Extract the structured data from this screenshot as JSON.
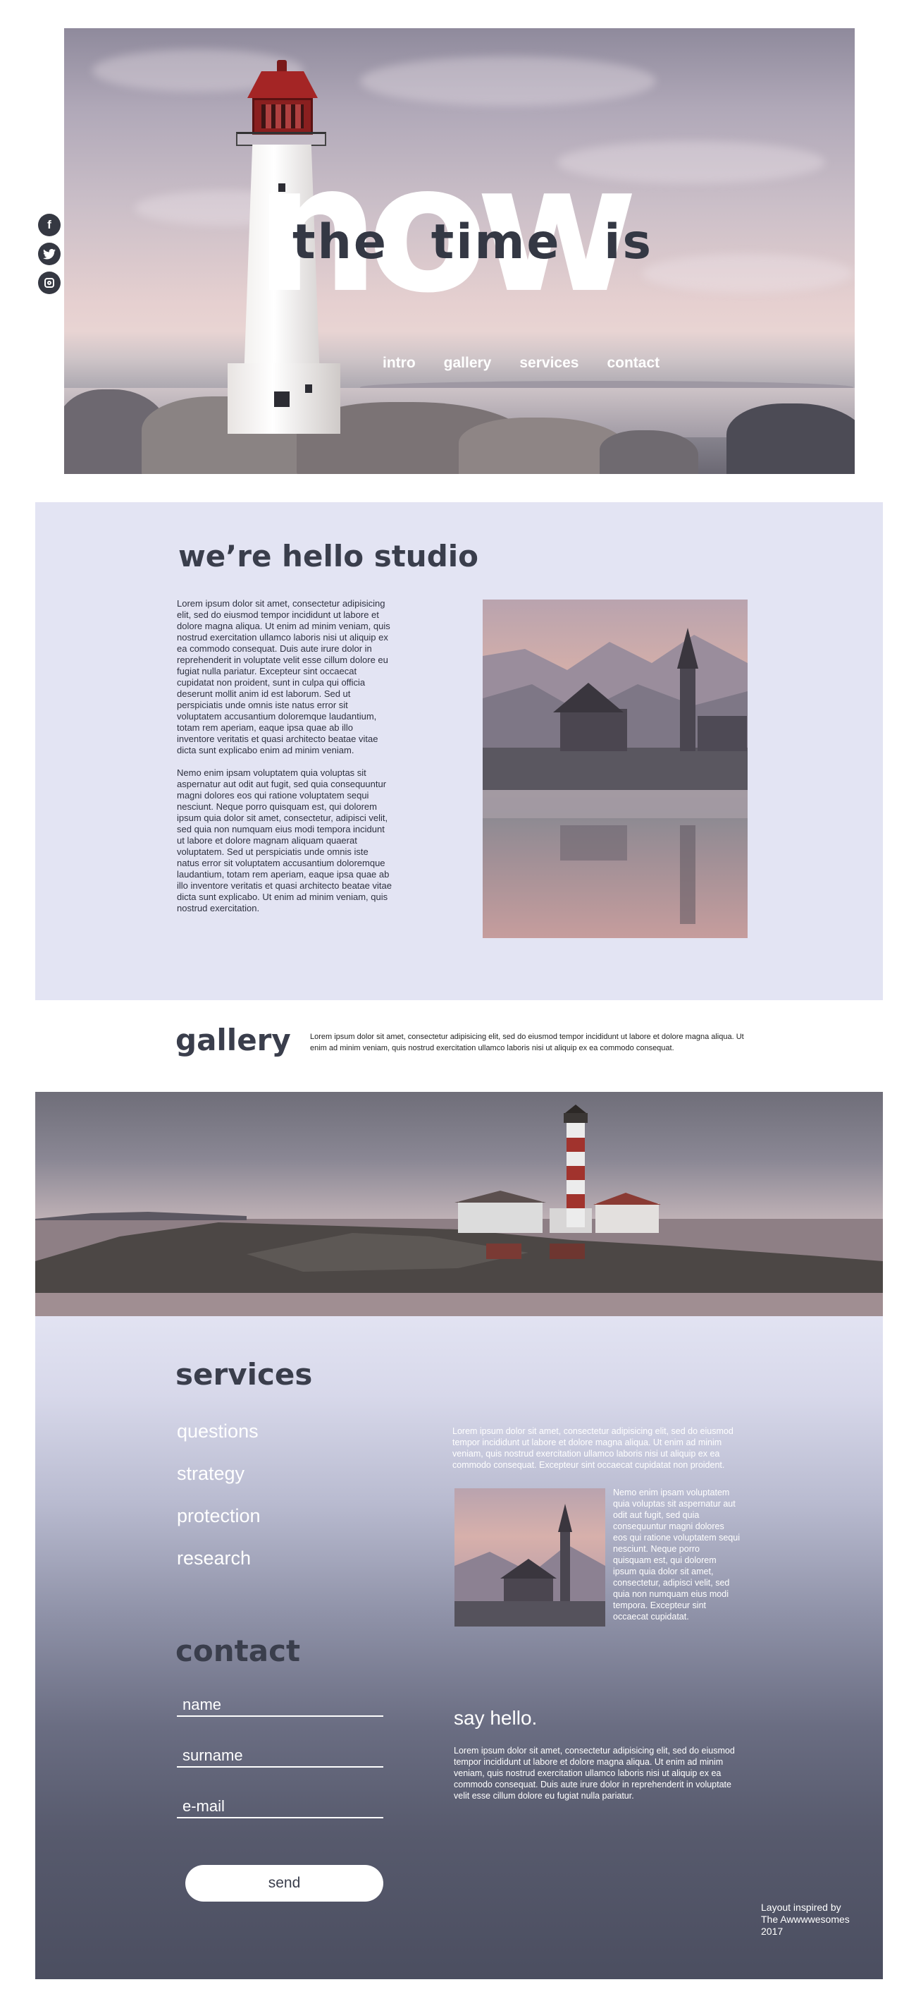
{
  "hero": {
    "big_word": "now",
    "headline": "the time is",
    "nav": [
      "intro",
      "gallery",
      "services",
      "contact"
    ]
  },
  "social": {
    "facebook": "f",
    "twitter": "twitter-icon",
    "instagram": "instagram-icon"
  },
  "about": {
    "title": "we’re hello studio",
    "paragraphs": [
      "Lorem ipsum dolor sit amet, consectetur adipisicing elit, sed do eiusmod tempor incididunt ut labore et dolore magna aliqua. Ut enim ad minim veniam, quis nostrud exercitation ullamco laboris nisi ut aliquip ex ea commodo consequat. Duis aute irure dolor in reprehenderit in voluptate velit esse cillum dolore eu fugiat nulla pariatur. Excepteur sint occaecat cupidatat non proident, sunt in culpa qui officia deserunt mollit anim id est laborum. Sed ut perspiciatis unde omnis iste natus error sit voluptatem accusantium doloremque laudantium, totam rem aperiam, eaque ipsa quae ab illo inventore veritatis et quasi architecto beatae vitae dicta sunt explicabo enim ad minim veniam.",
      "Nemo enim ipsam voluptatem quia voluptas sit aspernatur aut odit aut fugit, sed quia consequuntur magni dolores eos qui ratione voluptatem sequi nesciunt. Neque porro quisquam est, qui dolorem ipsum quia dolor sit amet, consectetur, adipisci velit, sed quia non numquam eius modi tempora incidunt ut labore et dolore magnam aliquam quaerat voluptatem. Sed ut perspiciatis unde omnis iste natus error sit voluptatem accusantium doloremque laudantium, totam rem aperiam, eaque ipsa quae ab illo inventore veritatis et quasi architecto beatae vitae dicta sunt explicabo. Ut enim ad minim veniam, quis nostrud exercitation."
    ]
  },
  "gallery": {
    "title": "gallery",
    "description": "Lorem ipsum dolor sit amet, consectetur adipisicing elit, sed do eiusmod tempor incididunt ut labore et dolore magna aliqua. Ut enim ad minim veniam, quis nostrud exercitation ullamco laboris nisi ut aliquip ex ea commodo consequat."
  },
  "services": {
    "title": "services",
    "items": [
      "questions",
      "strategy",
      "protection",
      "research"
    ],
    "intro": "Lorem ipsum dolor sit amet, consectetur adipisicing elit, sed do eiusmod tempor incididunt ut labore et dolore magna aliqua. Ut enim ad minim veniam, quis nostrud exercitation ullamco laboris nisi ut aliquip ex ea commodo consequat. Excepteur sint occaecat cupidatat non proident.",
    "side_text": "Nemo enim ipsam voluptatem quia voluptas sit aspernatur aut odit aut fugit, sed quia consequuntur magni dolores eos qui ratione voluptatem sequi nesciunt. Neque porro quisquam est, qui dolorem ipsum quia dolor sit amet, consectetur, adipisci velit, sed quia non numquam eius modi tempora. Excepteur sint occaecat cupidatat."
  },
  "contact": {
    "title": "contact",
    "fields": {
      "name": "name",
      "surname": "surname",
      "email": "e-mail"
    },
    "send_label": "send",
    "say_hello": "say hello.",
    "say_text": "Lorem ipsum dolor sit amet, consectetur adipisicing elit, sed do eiusmod tempor incididunt ut labore et dolore magna aliqua. Ut enim ad minim veniam, quis nostrud exercitation ullamco laboris nisi ut aliquip ex ea commodo consequat. Duis aute irure dolor in reprehenderit in voluptate velit esse cillum dolore eu fugiat nulla pariatur."
  },
  "footer": {
    "credit_line1": "Layout inspired by",
    "credit_line2": "The  Awwwwesomes",
    "credit_line3": "2017"
  },
  "colors": {
    "accent_dark": "#3a3e4c",
    "about_bg": "#e3e4f3",
    "lighthouse_red": "#a42525"
  }
}
